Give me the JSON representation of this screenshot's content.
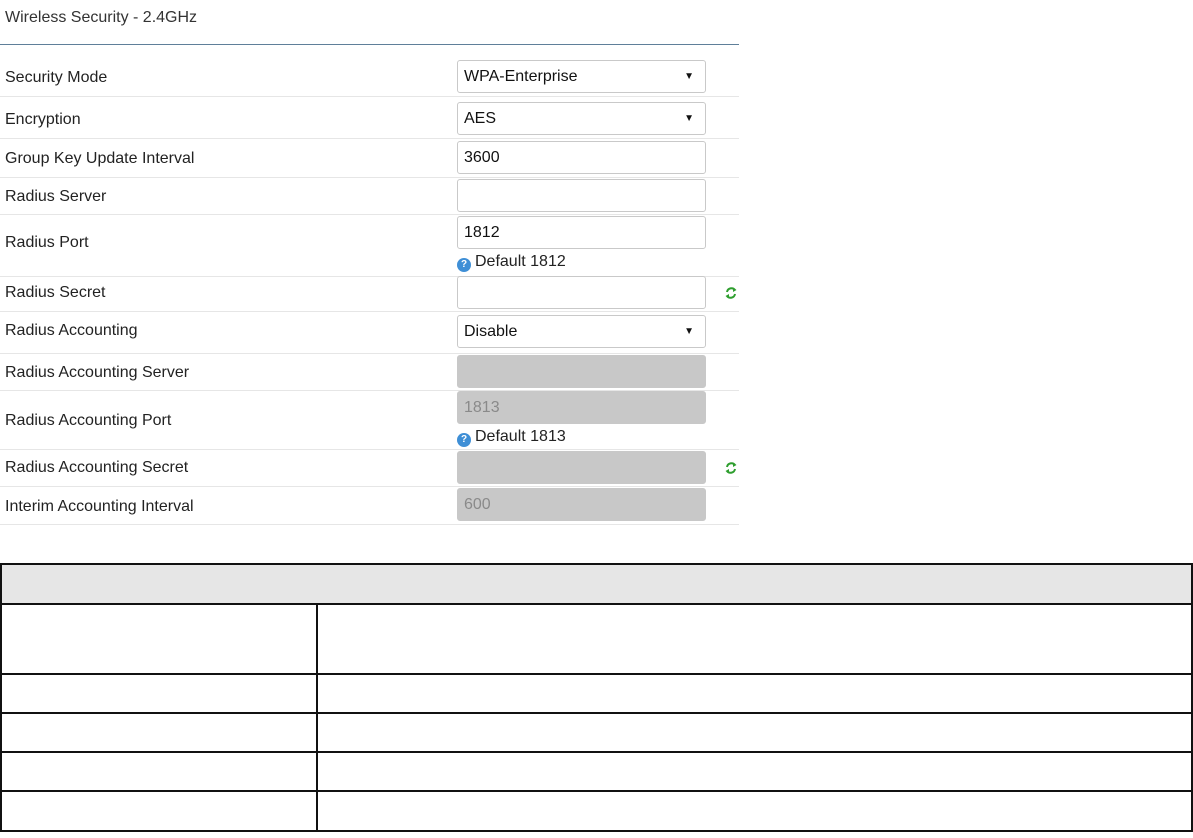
{
  "page": {
    "title": "Wireless Security - 2.4GHz"
  },
  "form": {
    "security_mode": {
      "label": "Security Mode",
      "value": "WPA-Enterprise"
    },
    "encryption": {
      "label": "Encryption",
      "value": "AES"
    },
    "group_key_update_interval": {
      "label": "Group Key Update Interval",
      "value": "3600"
    },
    "radius_server": {
      "label": "Radius Server",
      "value": ""
    },
    "radius_port": {
      "label": "Radius Port",
      "value": "1812",
      "hint": "Default 1812"
    },
    "radius_secret": {
      "label": "Radius Secret",
      "value": ""
    },
    "radius_accounting": {
      "label": "Radius Accounting",
      "value": "Disable"
    },
    "radius_accounting_server": {
      "label": "Radius Accounting Server",
      "value": ""
    },
    "radius_accounting_port": {
      "label": "Radius Accounting Port",
      "value": "1813",
      "hint": "Default 1813"
    },
    "radius_accounting_secret": {
      "label": "Radius Accounting Secret",
      "value": ""
    },
    "interim_accounting_interval": {
      "label": "Interim Accounting Interval",
      "value": "600"
    }
  },
  "icons": {
    "help": "question-circle-icon",
    "refresh": "refresh-icon"
  },
  "help_icon_glyph": "?",
  "colors": {
    "title_rule": "#5f7f99",
    "disabled_field": "#c8c8c8",
    "help_icon": "#3f8fd6",
    "refresh_icon": "#2e9e2e",
    "table_header": "#e6e6e6"
  },
  "reference_table": {
    "header": "",
    "rows": [
      [
        "",
        ""
      ],
      [
        "",
        ""
      ],
      [
        "",
        ""
      ],
      [
        "",
        ""
      ],
      [
        "",
        ""
      ]
    ]
  }
}
